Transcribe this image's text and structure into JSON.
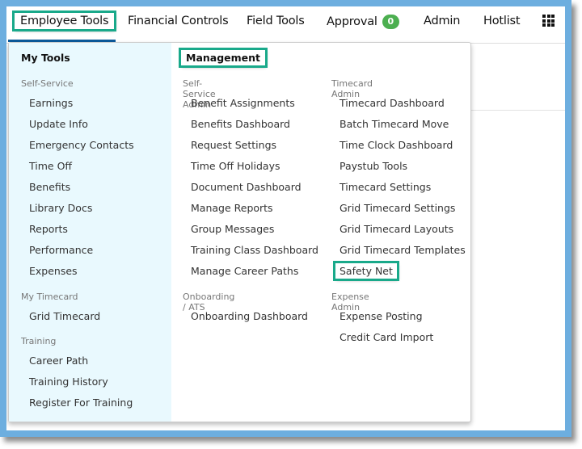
{
  "nav": {
    "items": [
      "Employee Tools",
      "Financial Controls",
      "Field Tools",
      "Approval",
      "Admin",
      "Hotlist"
    ],
    "approval_count": "0",
    "apps_icon": "grid-icon"
  },
  "my_tools": {
    "title": "My Tools",
    "sections": [
      {
        "label": "Self-Service",
        "items": [
          "Earnings",
          "Update Info",
          "Emergency Contacts",
          "Time Off",
          "Benefits",
          "Library Docs",
          "Reports",
          "Performance",
          "Expenses"
        ]
      },
      {
        "label": "My Timecard",
        "items": [
          "Grid Timecard"
        ]
      },
      {
        "label": "Training",
        "items": [
          "Career Path",
          "Training History",
          "Register For Training"
        ]
      }
    ]
  },
  "management": {
    "title": "Management",
    "col1": [
      {
        "label": "Self-Service Admin",
        "items": [
          "Benefit Assignments",
          "Benefits Dashboard",
          "Request Settings",
          "Time Off Holidays",
          "Document Dashboard",
          "Manage Reports",
          "Group Messages",
          "Training Class Dashboard",
          "Manage Career Paths"
        ]
      },
      {
        "label": "Onboarding / ATS",
        "items": [
          "Onboarding Dashboard"
        ]
      }
    ],
    "col2": [
      {
        "label": "Timecard Admin",
        "items": [
          "Timecard Dashboard",
          "Batch Timecard Move",
          "Time Clock Dashboard",
          "Paystub Tools",
          "Timecard Settings",
          "Grid Timecard Settings",
          "Grid Timecard Layouts",
          "Grid Timecard Templates",
          "Safety Net"
        ]
      },
      {
        "label": "Expense Admin",
        "items": [
          "Expense Posting",
          "Credit Card Import"
        ]
      }
    ]
  },
  "colors": {
    "highlight": "#19a98a",
    "frame": "#6daedf",
    "left_panel": "#e9f9fe",
    "badge": "#4caf50"
  }
}
